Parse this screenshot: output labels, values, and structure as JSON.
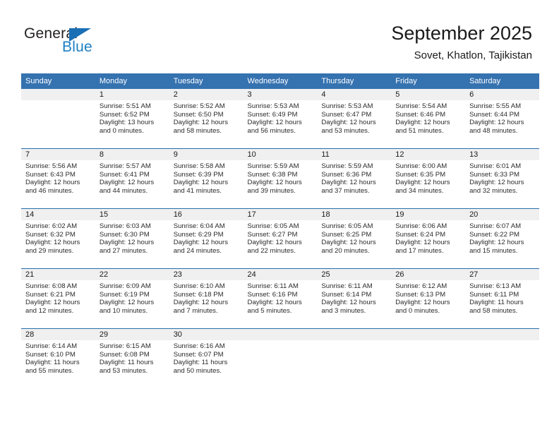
{
  "brand": {
    "name_part1": "General",
    "name_part2": "Blue",
    "triangle_icon": "triangle-icon",
    "accent_color": "#1c7fc4"
  },
  "header": {
    "title": "September 2025",
    "subtitle": "Sovet, Khatlon, Tajikistan"
  },
  "theme": {
    "header_bg": "#3572b0",
    "row_divider": "#2a6fad",
    "daynum_band_bg": "#f0f0f0"
  },
  "weekday_headers": [
    "Sunday",
    "Monday",
    "Tuesday",
    "Wednesday",
    "Thursday",
    "Friday",
    "Saturday"
  ],
  "weeks": [
    [
      {
        "day": "",
        "empty": true,
        "sunrise": "",
        "sunset": "",
        "daylight1": "",
        "daylight2": ""
      },
      {
        "day": "1",
        "sunrise": "Sunrise: 5:51 AM",
        "sunset": "Sunset: 6:52 PM",
        "daylight1": "Daylight: 13 hours",
        "daylight2": "and 0 minutes."
      },
      {
        "day": "2",
        "sunrise": "Sunrise: 5:52 AM",
        "sunset": "Sunset: 6:50 PM",
        "daylight1": "Daylight: 12 hours",
        "daylight2": "and 58 minutes."
      },
      {
        "day": "3",
        "sunrise": "Sunrise: 5:53 AM",
        "sunset": "Sunset: 6:49 PM",
        "daylight1": "Daylight: 12 hours",
        "daylight2": "and 56 minutes."
      },
      {
        "day": "4",
        "sunrise": "Sunrise: 5:53 AM",
        "sunset": "Sunset: 6:47 PM",
        "daylight1": "Daylight: 12 hours",
        "daylight2": "and 53 minutes."
      },
      {
        "day": "5",
        "sunrise": "Sunrise: 5:54 AM",
        "sunset": "Sunset: 6:46 PM",
        "daylight1": "Daylight: 12 hours",
        "daylight2": "and 51 minutes."
      },
      {
        "day": "6",
        "sunrise": "Sunrise: 5:55 AM",
        "sunset": "Sunset: 6:44 PM",
        "daylight1": "Daylight: 12 hours",
        "daylight2": "and 48 minutes."
      }
    ],
    [
      {
        "day": "7",
        "sunrise": "Sunrise: 5:56 AM",
        "sunset": "Sunset: 6:43 PM",
        "daylight1": "Daylight: 12 hours",
        "daylight2": "and 46 minutes."
      },
      {
        "day": "8",
        "sunrise": "Sunrise: 5:57 AM",
        "sunset": "Sunset: 6:41 PM",
        "daylight1": "Daylight: 12 hours",
        "daylight2": "and 44 minutes."
      },
      {
        "day": "9",
        "sunrise": "Sunrise: 5:58 AM",
        "sunset": "Sunset: 6:39 PM",
        "daylight1": "Daylight: 12 hours",
        "daylight2": "and 41 minutes."
      },
      {
        "day": "10",
        "sunrise": "Sunrise: 5:59 AM",
        "sunset": "Sunset: 6:38 PM",
        "daylight1": "Daylight: 12 hours",
        "daylight2": "and 39 minutes."
      },
      {
        "day": "11",
        "sunrise": "Sunrise: 5:59 AM",
        "sunset": "Sunset: 6:36 PM",
        "daylight1": "Daylight: 12 hours",
        "daylight2": "and 37 minutes."
      },
      {
        "day": "12",
        "sunrise": "Sunrise: 6:00 AM",
        "sunset": "Sunset: 6:35 PM",
        "daylight1": "Daylight: 12 hours",
        "daylight2": "and 34 minutes."
      },
      {
        "day": "13",
        "sunrise": "Sunrise: 6:01 AM",
        "sunset": "Sunset: 6:33 PM",
        "daylight1": "Daylight: 12 hours",
        "daylight2": "and 32 minutes."
      }
    ],
    [
      {
        "day": "14",
        "sunrise": "Sunrise: 6:02 AM",
        "sunset": "Sunset: 6:32 PM",
        "daylight1": "Daylight: 12 hours",
        "daylight2": "and 29 minutes."
      },
      {
        "day": "15",
        "sunrise": "Sunrise: 6:03 AM",
        "sunset": "Sunset: 6:30 PM",
        "daylight1": "Daylight: 12 hours",
        "daylight2": "and 27 minutes."
      },
      {
        "day": "16",
        "sunrise": "Sunrise: 6:04 AM",
        "sunset": "Sunset: 6:29 PM",
        "daylight1": "Daylight: 12 hours",
        "daylight2": "and 24 minutes."
      },
      {
        "day": "17",
        "sunrise": "Sunrise: 6:05 AM",
        "sunset": "Sunset: 6:27 PM",
        "daylight1": "Daylight: 12 hours",
        "daylight2": "and 22 minutes."
      },
      {
        "day": "18",
        "sunrise": "Sunrise: 6:05 AM",
        "sunset": "Sunset: 6:25 PM",
        "daylight1": "Daylight: 12 hours",
        "daylight2": "and 20 minutes."
      },
      {
        "day": "19",
        "sunrise": "Sunrise: 6:06 AM",
        "sunset": "Sunset: 6:24 PM",
        "daylight1": "Daylight: 12 hours",
        "daylight2": "and 17 minutes."
      },
      {
        "day": "20",
        "sunrise": "Sunrise: 6:07 AM",
        "sunset": "Sunset: 6:22 PM",
        "daylight1": "Daylight: 12 hours",
        "daylight2": "and 15 minutes."
      }
    ],
    [
      {
        "day": "21",
        "sunrise": "Sunrise: 6:08 AM",
        "sunset": "Sunset: 6:21 PM",
        "daylight1": "Daylight: 12 hours",
        "daylight2": "and 12 minutes."
      },
      {
        "day": "22",
        "sunrise": "Sunrise: 6:09 AM",
        "sunset": "Sunset: 6:19 PM",
        "daylight1": "Daylight: 12 hours",
        "daylight2": "and 10 minutes."
      },
      {
        "day": "23",
        "sunrise": "Sunrise: 6:10 AM",
        "sunset": "Sunset: 6:18 PM",
        "daylight1": "Daylight: 12 hours",
        "daylight2": "and 7 minutes."
      },
      {
        "day": "24",
        "sunrise": "Sunrise: 6:11 AM",
        "sunset": "Sunset: 6:16 PM",
        "daylight1": "Daylight: 12 hours",
        "daylight2": "and 5 minutes."
      },
      {
        "day": "25",
        "sunrise": "Sunrise: 6:11 AM",
        "sunset": "Sunset: 6:14 PM",
        "daylight1": "Daylight: 12 hours",
        "daylight2": "and 3 minutes."
      },
      {
        "day": "26",
        "sunrise": "Sunrise: 6:12 AM",
        "sunset": "Sunset: 6:13 PM",
        "daylight1": "Daylight: 12 hours",
        "daylight2": "and 0 minutes."
      },
      {
        "day": "27",
        "sunrise": "Sunrise: 6:13 AM",
        "sunset": "Sunset: 6:11 PM",
        "daylight1": "Daylight: 11 hours",
        "daylight2": "and 58 minutes."
      }
    ],
    [
      {
        "day": "28",
        "sunrise": "Sunrise: 6:14 AM",
        "sunset": "Sunset: 6:10 PM",
        "daylight1": "Daylight: 11 hours",
        "daylight2": "and 55 minutes."
      },
      {
        "day": "29",
        "sunrise": "Sunrise: 6:15 AM",
        "sunset": "Sunset: 6:08 PM",
        "daylight1": "Daylight: 11 hours",
        "daylight2": "and 53 minutes."
      },
      {
        "day": "30",
        "sunrise": "Sunrise: 6:16 AM",
        "sunset": "Sunset: 6:07 PM",
        "daylight1": "Daylight: 11 hours",
        "daylight2": "and 50 minutes."
      },
      {
        "day": "",
        "empty": true,
        "sunrise": "",
        "sunset": "",
        "daylight1": "",
        "daylight2": ""
      },
      {
        "day": "",
        "empty": true,
        "sunrise": "",
        "sunset": "",
        "daylight1": "",
        "daylight2": ""
      },
      {
        "day": "",
        "empty": true,
        "sunrise": "",
        "sunset": "",
        "daylight1": "",
        "daylight2": ""
      },
      {
        "day": "",
        "empty": true,
        "sunrise": "",
        "sunset": "",
        "daylight1": "",
        "daylight2": ""
      }
    ]
  ]
}
